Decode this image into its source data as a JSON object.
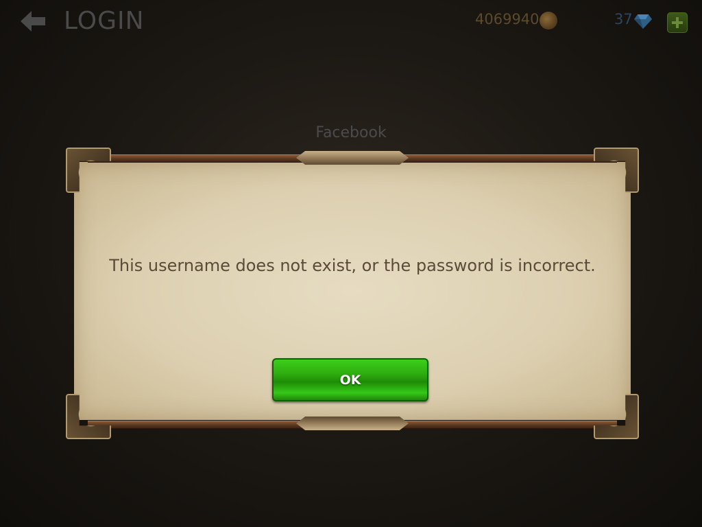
{
  "topbar": {
    "screen_title": "LOGIN",
    "gold_amount": "4069940",
    "gem_amount": "37",
    "back_icon": "back-arrow-icon",
    "gold_icon": "gold-coin-icon",
    "gem_icon": "diamond-icon",
    "add_icon": "plus-icon"
  },
  "dialog": {
    "label": "Facebook",
    "message": "This username does not exist, or the password is incorrect.",
    "ok_label": "OK"
  },
  "colors": {
    "ok_button": "#2fae10",
    "parchment": "#ddd0b1",
    "frame": "#5e3a22"
  }
}
